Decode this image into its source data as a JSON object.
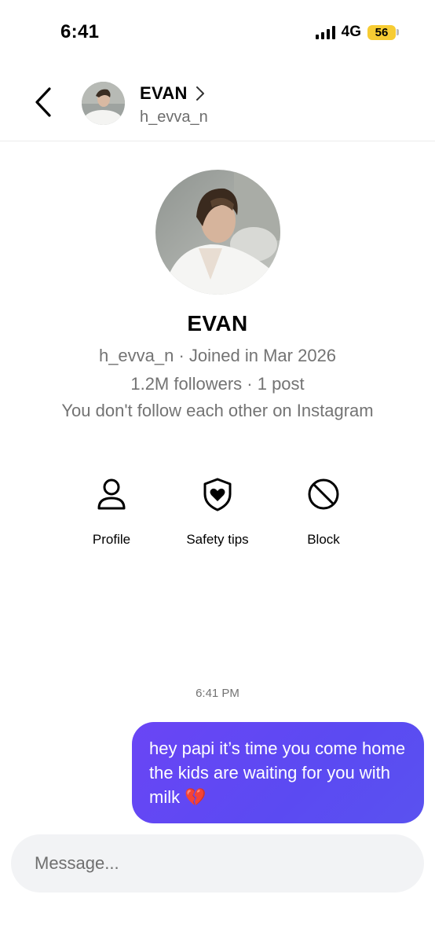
{
  "status_bar": {
    "time": "6:41",
    "network": "4G",
    "battery": "56",
    "battery_color": "#f7cc33"
  },
  "header": {
    "name": "EVAN",
    "handle": "h_evva_n",
    "back_icon": "chevron-left-icon",
    "chevron_icon": "chevron-right-icon"
  },
  "profile": {
    "name": "EVAN",
    "meta_line": "h_evva_n · Joined in Mar 2026",
    "stats_line": "1.2M followers · 1 post",
    "relationship_line": "You don't follow each other on Instagram"
  },
  "actions": [
    {
      "label": "Profile",
      "icon": "person-icon"
    },
    {
      "label": "Safety tips",
      "icon": "shield-heart-icon"
    },
    {
      "label": "Block",
      "icon": "block-icon"
    }
  ],
  "chat": {
    "timestamp": "6:41 PM",
    "messages": [
      {
        "text": "hey papi it’s time you come home the kids are waiting for you with milk 💔",
        "sender": "me"
      }
    ],
    "bubble_color": "#5b4af2"
  },
  "composer": {
    "placeholder": "Message..."
  }
}
